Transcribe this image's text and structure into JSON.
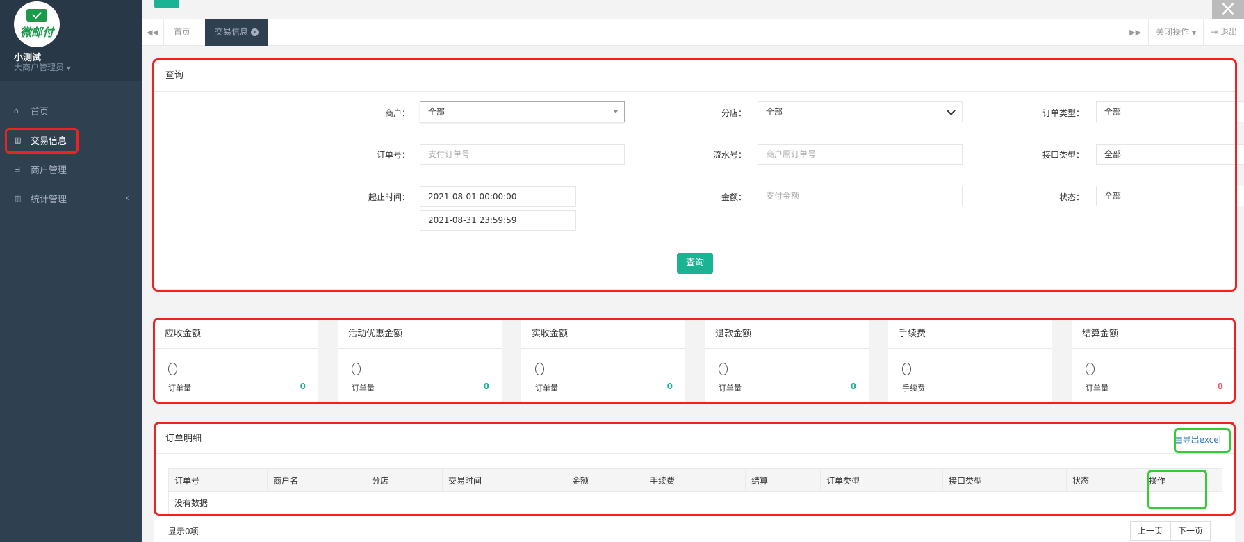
{
  "sidebar": {
    "logo_text": "微邮付",
    "user_name": "小测试",
    "user_role": "大商户管理员",
    "items": [
      {
        "label": "首页",
        "icon": "home-icon"
      },
      {
        "label": "交易信息",
        "icon": "bar-chart-icon"
      },
      {
        "label": "商户管理",
        "icon": "cart-icon"
      },
      {
        "label": "统计管理",
        "icon": "bar-chart-icon"
      }
    ]
  },
  "tabs": {
    "home": "首页",
    "active": "交易信息",
    "close_ops": "关闭操作",
    "logout": "退出"
  },
  "query": {
    "title": "查询",
    "merchant_label": "商户：",
    "merchant_value": "全部",
    "branch_label": "分店：",
    "branch_value": "全部",
    "order_type_label": "订单类型：",
    "order_type_value": "全部",
    "order_no_label": "订单号：",
    "order_no_placeholder": "支付订单号",
    "serial_label": "流水号：",
    "serial_placeholder": "商户原订单号",
    "api_type_label": "接口类型：",
    "api_type_value": "全部",
    "time_label": "起止时间：",
    "start_time": "2021-08-01 00:00:00",
    "end_time": "2021-08-31 23:59:59",
    "amount_label": "金额：",
    "amount_placeholder": "支付金额",
    "status_label": "状态：",
    "status_value": "全部",
    "submit": "查询"
  },
  "summary": [
    {
      "title": "应收金额",
      "value": "0",
      "sub": "订单量",
      "count": "0"
    },
    {
      "title": "活动优惠金额",
      "value": "0",
      "sub": "订单量",
      "count": "0"
    },
    {
      "title": "实收金额",
      "value": "0",
      "sub": "订单量",
      "count": "0"
    },
    {
      "title": "退款金额",
      "value": "0",
      "sub": "订单量",
      "count": "0"
    },
    {
      "title": "手续费",
      "value": "0",
      "sub": "手续费",
      "count": ""
    },
    {
      "title": "结算金额",
      "value": "0",
      "sub": "订单量",
      "count": "0"
    }
  ],
  "orders": {
    "title": "订单明细",
    "export": "导出excel",
    "columns": [
      "订单号",
      "商户名",
      "分店",
      "交易时间",
      "金额",
      "手续费",
      "结算",
      "订单类型",
      "接口类型",
      "状态",
      "操作"
    ],
    "empty": "没有数据",
    "footer": "显示0项",
    "prev": "上一页",
    "next": "下一页"
  },
  "colors": {
    "accent": "#1ab394",
    "sidebar": "#2f4050",
    "highlight": "#ee2222",
    "green_highlight": "#33cc33",
    "negative": "#ed5565"
  }
}
